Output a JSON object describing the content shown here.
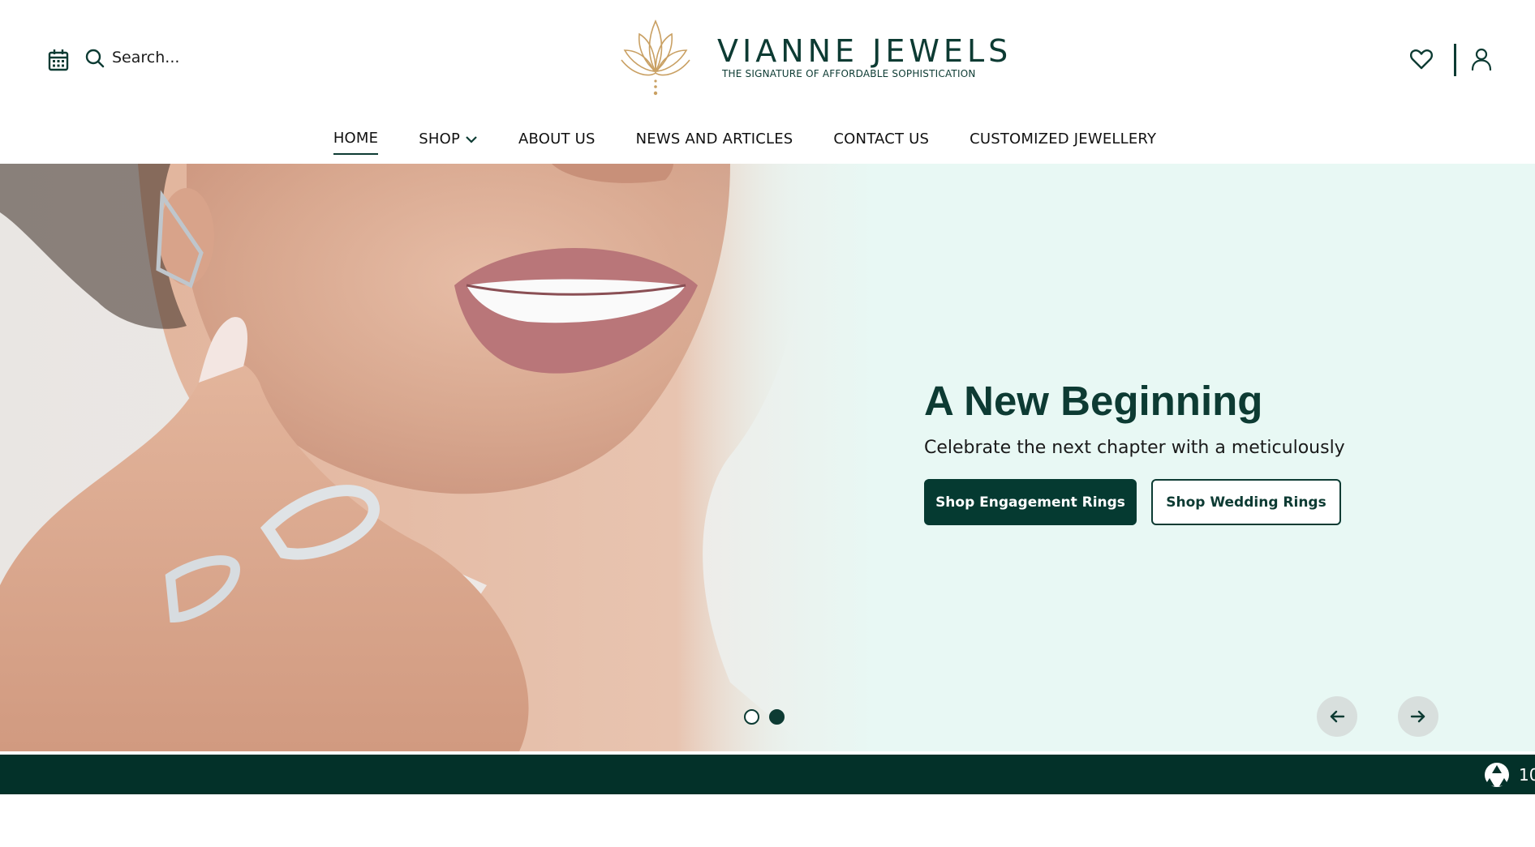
{
  "header": {
    "search_placeholder": "Search...",
    "brand_name": "VIANNE JEWELS",
    "brand_tagline": "THE SIGNATURE OF AFFORDABLE SOPHISTICATION",
    "icons": [
      "calendar-icon",
      "search-icon",
      "lotus-logo-icon",
      "heart-icon",
      "user-icon"
    ]
  },
  "nav": {
    "items": [
      {
        "label": "HOME",
        "active": true
      },
      {
        "label": "SHOP",
        "has_dropdown": true
      },
      {
        "label": "ABOUT US"
      },
      {
        "label": "NEWS AND ARTICLES"
      },
      {
        "label": "CONTACT US"
      },
      {
        "label": "CUSTOMIZED JEWELLERY"
      }
    ]
  },
  "hero": {
    "title": "A New Beginning",
    "subtitle": "Celebrate the next chapter with a meticulously",
    "primary_button": "Shop Engagement Rings",
    "secondary_button": "Shop Wedding Rings",
    "slides_total": 2,
    "active_slide": 2,
    "background_color": "#e8f8f4"
  },
  "band": {
    "text": "10",
    "icon": "recycle-icon"
  },
  "colors": {
    "brand_dark": "#053a31",
    "brand_gold": "#c9a063",
    "hero_bg": "#e8f8f4"
  }
}
